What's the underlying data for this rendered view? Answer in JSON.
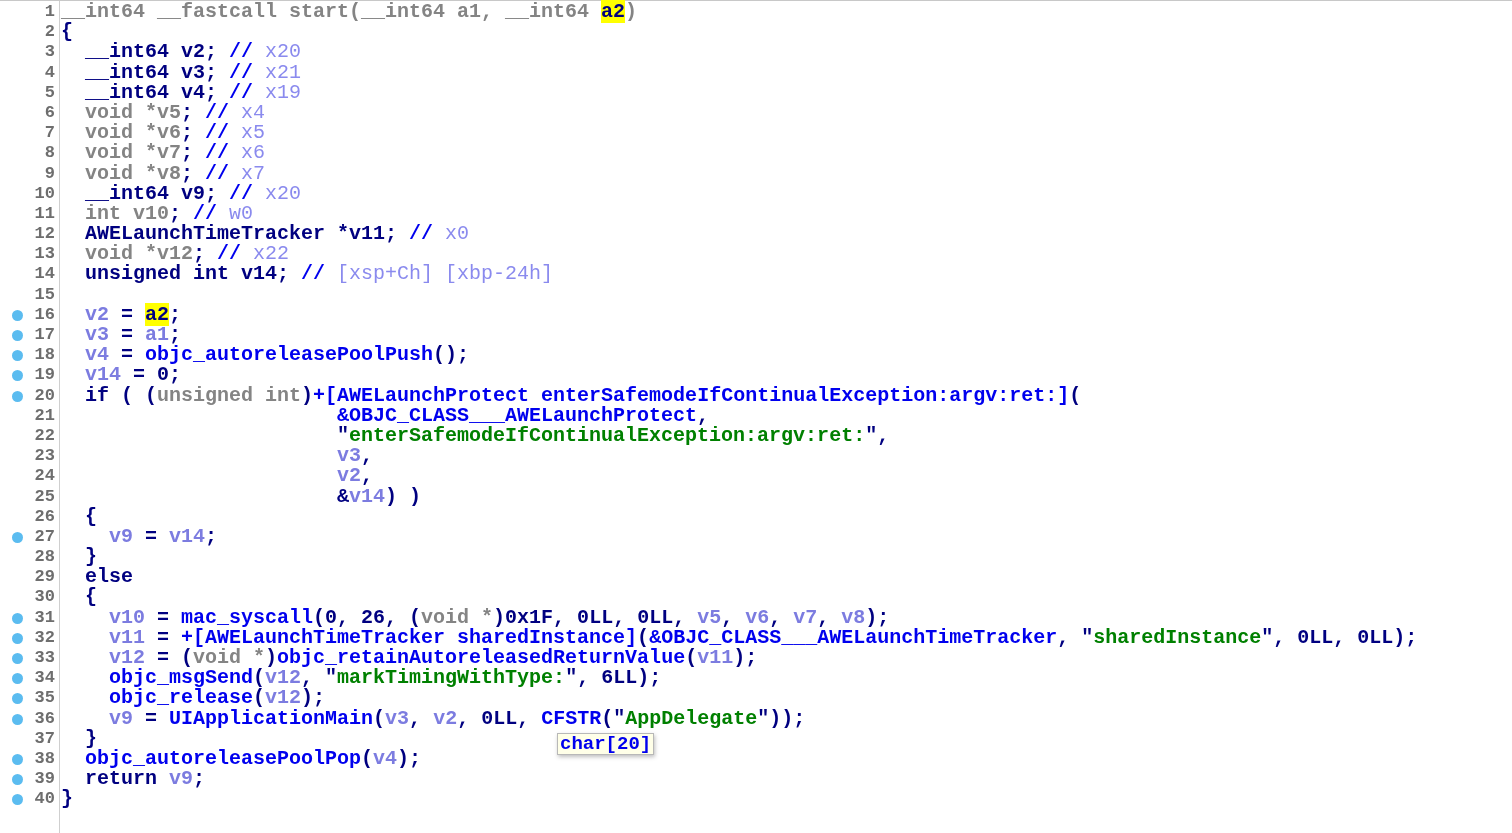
{
  "lines": [
    {
      "number": "1",
      "breakpoint": false,
      "segments": [
        {
          "kind": "type",
          "text": "__int64 __fastcall start(__int64 a1, __int64 "
        },
        {
          "kind": "match",
          "text": "a2"
        },
        {
          "kind": "type",
          "text": ")"
        }
      ]
    },
    {
      "number": "2",
      "breakpoint": false,
      "segments": [
        {
          "kind": "plain",
          "text": "{"
        }
      ]
    },
    {
      "number": "3",
      "breakpoint": false,
      "segments": [
        {
          "kind": "plain",
          "text": "  __int64 v2; "
        },
        {
          "kind": "func",
          "text": "//"
        },
        {
          "kind": "note",
          "text": " x20"
        }
      ]
    },
    {
      "number": "4",
      "breakpoint": false,
      "segments": [
        {
          "kind": "plain",
          "text": "  __int64 v3; "
        },
        {
          "kind": "func",
          "text": "//"
        },
        {
          "kind": "note",
          "text": " x21"
        }
      ]
    },
    {
      "number": "5",
      "breakpoint": false,
      "segments": [
        {
          "kind": "plain",
          "text": "  __int64 v4; "
        },
        {
          "kind": "func",
          "text": "//"
        },
        {
          "kind": "note",
          "text": " x19"
        }
      ]
    },
    {
      "number": "6",
      "breakpoint": false,
      "segments": [
        {
          "kind": "type",
          "text": "  void *v5"
        },
        {
          "kind": "plain",
          "text": "; "
        },
        {
          "kind": "func",
          "text": "//"
        },
        {
          "kind": "note",
          "text": " x4"
        }
      ]
    },
    {
      "number": "7",
      "breakpoint": false,
      "segments": [
        {
          "kind": "type",
          "text": "  void *v6"
        },
        {
          "kind": "plain",
          "text": "; "
        },
        {
          "kind": "func",
          "text": "//"
        },
        {
          "kind": "note",
          "text": " x5"
        }
      ]
    },
    {
      "number": "8",
      "breakpoint": false,
      "segments": [
        {
          "kind": "type",
          "text": "  void *v7"
        },
        {
          "kind": "plain",
          "text": "; "
        },
        {
          "kind": "func",
          "text": "//"
        },
        {
          "kind": "note",
          "text": " x6"
        }
      ]
    },
    {
      "number": "9",
      "breakpoint": false,
      "segments": [
        {
          "kind": "type",
          "text": "  void *v8"
        },
        {
          "kind": "plain",
          "text": "; "
        },
        {
          "kind": "func",
          "text": "//"
        },
        {
          "kind": "note",
          "text": " x7"
        }
      ]
    },
    {
      "number": "10",
      "breakpoint": false,
      "segments": [
        {
          "kind": "plain",
          "text": "  __int64 v9; "
        },
        {
          "kind": "func",
          "text": "//"
        },
        {
          "kind": "note",
          "text": " x20"
        }
      ]
    },
    {
      "number": "11",
      "breakpoint": false,
      "segments": [
        {
          "kind": "type",
          "text": "  int v10"
        },
        {
          "kind": "plain",
          "text": "; "
        },
        {
          "kind": "func",
          "text": "//"
        },
        {
          "kind": "note",
          "text": " w0"
        }
      ]
    },
    {
      "number": "12",
      "breakpoint": false,
      "segments": [
        {
          "kind": "plain",
          "text": "  AWELaunchTimeTracker *v11; "
        },
        {
          "kind": "func",
          "text": "//"
        },
        {
          "kind": "note",
          "text": " x0"
        }
      ]
    },
    {
      "number": "13",
      "breakpoint": false,
      "segments": [
        {
          "kind": "type",
          "text": "  void *v12"
        },
        {
          "kind": "plain",
          "text": "; "
        },
        {
          "kind": "func",
          "text": "//"
        },
        {
          "kind": "note",
          "text": " x22"
        }
      ]
    },
    {
      "number": "14",
      "breakpoint": false,
      "segments": [
        {
          "kind": "plain",
          "text": "  unsigned int v14; "
        },
        {
          "kind": "func",
          "text": "//"
        },
        {
          "kind": "note",
          "text": " [xsp+Ch] [xbp-24h]"
        }
      ]
    },
    {
      "number": "15",
      "breakpoint": false
    },
    {
      "number": "16",
      "breakpoint": true,
      "segments": [
        {
          "kind": "var",
          "text": "  v2"
        },
        {
          "kind": "plain",
          "text": " = "
        },
        {
          "kind": "match",
          "text": "a2"
        },
        {
          "kind": "plain",
          "text": ";"
        }
      ]
    },
    {
      "number": "17",
      "breakpoint": true,
      "segments": [
        {
          "kind": "var",
          "text": "  v3"
        },
        {
          "kind": "plain",
          "text": " = "
        },
        {
          "kind": "var",
          "text": "a1"
        },
        {
          "kind": "plain",
          "text": ";"
        }
      ]
    },
    {
      "number": "18",
      "breakpoint": true,
      "segments": [
        {
          "kind": "var",
          "text": "  v4"
        },
        {
          "kind": "plain",
          "text": " = "
        },
        {
          "kind": "func",
          "text": "objc_autoreleasePoolPush"
        },
        {
          "kind": "plain",
          "text": "();"
        }
      ]
    },
    {
      "number": "19",
      "breakpoint": true,
      "segments": [
        {
          "kind": "var",
          "text": "  v14"
        },
        {
          "kind": "plain",
          "text": " = 0;"
        }
      ]
    },
    {
      "number": "20",
      "breakpoint": true,
      "segments": [
        {
          "kind": "plain",
          "text": "  if ( ("
        },
        {
          "kind": "type",
          "text": "unsigned int"
        },
        {
          "kind": "plain",
          "text": ")"
        },
        {
          "kind": "func",
          "text": "+[AWELaunchProtect enterSafemodeIfContinualException:argv:ret:]"
        },
        {
          "kind": "plain",
          "text": "("
        }
      ]
    },
    {
      "number": "21",
      "breakpoint": false,
      "segments": [
        {
          "kind": "func",
          "text": "                       &OBJC_CLASS___AWELaunchProtect"
        },
        {
          "kind": "plain",
          "text": ","
        }
      ]
    },
    {
      "number": "22",
      "breakpoint": false,
      "segments": [
        {
          "kind": "plain",
          "text": "                       \""
        },
        {
          "kind": "string",
          "text": "enterSafemodeIfContinualException:argv:ret:"
        },
        {
          "kind": "plain",
          "text": "\","
        }
      ]
    },
    {
      "number": "23",
      "breakpoint": false,
      "segments": [
        {
          "kind": "var",
          "text": "                       v3"
        },
        {
          "kind": "plain",
          "text": ","
        }
      ]
    },
    {
      "number": "24",
      "breakpoint": false,
      "segments": [
        {
          "kind": "var",
          "text": "                       v2"
        },
        {
          "kind": "plain",
          "text": ","
        }
      ]
    },
    {
      "number": "25",
      "breakpoint": false,
      "segments": [
        {
          "kind": "plain",
          "text": "                       &"
        },
        {
          "kind": "var",
          "text": "v14"
        },
        {
          "kind": "plain",
          "text": ") )"
        }
      ]
    },
    {
      "number": "26",
      "breakpoint": false,
      "segments": [
        {
          "kind": "plain",
          "text": "  {"
        }
      ]
    },
    {
      "number": "27",
      "breakpoint": true,
      "segments": [
        {
          "kind": "var",
          "text": "    v9"
        },
        {
          "kind": "plain",
          "text": " = "
        },
        {
          "kind": "var",
          "text": "v14"
        },
        {
          "kind": "plain",
          "text": ";"
        }
      ]
    },
    {
      "number": "28",
      "breakpoint": false,
      "segments": [
        {
          "kind": "plain",
          "text": "  }"
        }
      ]
    },
    {
      "number": "29",
      "breakpoint": false,
      "segments": [
        {
          "kind": "plain",
          "text": "  else"
        }
      ]
    },
    {
      "number": "30",
      "breakpoint": false,
      "segments": [
        {
          "kind": "plain",
          "text": "  {"
        }
      ]
    },
    {
      "number": "31",
      "breakpoint": true,
      "segments": [
        {
          "kind": "var",
          "text": "    v10"
        },
        {
          "kind": "plain",
          "text": " = "
        },
        {
          "kind": "func",
          "text": "mac_syscall"
        },
        {
          "kind": "plain",
          "text": "(0, 26, ("
        },
        {
          "kind": "type",
          "text": "void *"
        },
        {
          "kind": "plain",
          "text": ")0x1F, 0LL, 0LL, "
        },
        {
          "kind": "var",
          "text": "v5"
        },
        {
          "kind": "plain",
          "text": ", "
        },
        {
          "kind": "var",
          "text": "v6"
        },
        {
          "kind": "plain",
          "text": ", "
        },
        {
          "kind": "var",
          "text": "v7"
        },
        {
          "kind": "plain",
          "text": ", "
        },
        {
          "kind": "var",
          "text": "v8"
        },
        {
          "kind": "plain",
          "text": ");"
        }
      ]
    },
    {
      "number": "32",
      "breakpoint": true,
      "segments": [
        {
          "kind": "var",
          "text": "    v11"
        },
        {
          "kind": "plain",
          "text": " = "
        },
        {
          "kind": "func",
          "text": "+[AWELaunchTimeTracker sharedInstance]"
        },
        {
          "kind": "plain",
          "text": "("
        },
        {
          "kind": "func",
          "text": "&OBJC_CLASS___AWELaunchTimeTracker"
        },
        {
          "kind": "plain",
          "text": ", \""
        },
        {
          "kind": "string",
          "text": "sharedInstance"
        },
        {
          "kind": "plain",
          "text": "\", 0LL, 0LL);"
        }
      ]
    },
    {
      "number": "33",
      "breakpoint": true,
      "segments": [
        {
          "kind": "var",
          "text": "    v12"
        },
        {
          "kind": "plain",
          "text": " = ("
        },
        {
          "kind": "type",
          "text": "void *"
        },
        {
          "kind": "plain",
          "text": ")"
        },
        {
          "kind": "func",
          "text": "objc_retainAutoreleasedReturnValue"
        },
        {
          "kind": "plain",
          "text": "("
        },
        {
          "kind": "var",
          "text": "v11"
        },
        {
          "kind": "plain",
          "text": ");"
        }
      ]
    },
    {
      "number": "34",
      "breakpoint": true,
      "segments": [
        {
          "kind": "func",
          "text": "    objc_msgSend"
        },
        {
          "kind": "plain",
          "text": "("
        },
        {
          "kind": "var",
          "text": "v12"
        },
        {
          "kind": "plain",
          "text": ", \""
        },
        {
          "kind": "string",
          "text": "markTimingWithType:"
        },
        {
          "kind": "plain",
          "text": "\", 6LL);"
        }
      ]
    },
    {
      "number": "35",
      "breakpoint": true,
      "segments": [
        {
          "kind": "func",
          "text": "    objc_release"
        },
        {
          "kind": "plain",
          "text": "("
        },
        {
          "kind": "var",
          "text": "v12"
        },
        {
          "kind": "plain",
          "text": ");"
        }
      ]
    },
    {
      "number": "36",
      "breakpoint": true,
      "segments": [
        {
          "kind": "var",
          "text": "    v9"
        },
        {
          "kind": "plain",
          "text": " = "
        },
        {
          "kind": "func",
          "text": "UIApplicationMain"
        },
        {
          "kind": "plain",
          "text": "("
        },
        {
          "kind": "var",
          "text": "v3"
        },
        {
          "kind": "plain",
          "text": ", "
        },
        {
          "kind": "var",
          "text": "v2"
        },
        {
          "kind": "plain",
          "text": ", 0LL, "
        },
        {
          "kind": "func",
          "text": "CFSTR"
        },
        {
          "kind": "plain",
          "text": "(\""
        },
        {
          "kind": "string",
          "text": "AppDelegate"
        },
        {
          "kind": "plain",
          "text": "\"));"
        }
      ]
    },
    {
      "number": "37",
      "breakpoint": false,
      "segments": [
        {
          "kind": "plain",
          "text": "  }"
        }
      ]
    },
    {
      "number": "38",
      "breakpoint": true,
      "segments": [
        {
          "kind": "func",
          "text": "  objc_autoreleasePoolPop"
        },
        {
          "kind": "plain",
          "text": "("
        },
        {
          "kind": "var",
          "text": "v4"
        },
        {
          "kind": "plain",
          "text": ");"
        }
      ]
    },
    {
      "number": "39",
      "breakpoint": true,
      "segments": [
        {
          "kind": "plain",
          "text": "  return "
        },
        {
          "kind": "var",
          "text": "v9"
        },
        {
          "kind": "plain",
          "text": ";"
        }
      ]
    },
    {
      "number": "40",
      "breakpoint": true,
      "segments": [
        {
          "kind": "plain",
          "text": "}"
        }
      ]
    }
  ],
  "tooltip": {
    "text": "char[20]"
  }
}
